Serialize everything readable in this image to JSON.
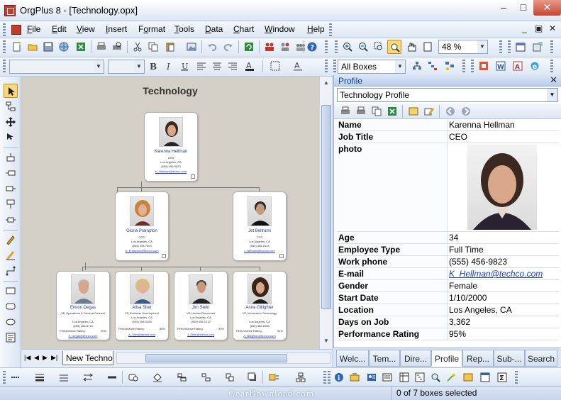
{
  "window": {
    "title": "OrgPlus 8 - [Technology.opx]",
    "minimize": "–",
    "maximize": "□",
    "close": "✕"
  },
  "menu": [
    "File",
    "Edit",
    "View",
    "Insert",
    "Format",
    "Tools",
    "Data",
    "Chart",
    "Window",
    "Help"
  ],
  "menu_underline": [
    "F",
    "E",
    "V",
    "I",
    "o",
    "T",
    "D",
    "C",
    "W",
    "H"
  ],
  "mdi_controls": {
    "minimize": "_",
    "restore": "▣",
    "close": "✕"
  },
  "toolbar": {
    "zoom": "48 %",
    "box_filter": "All Boxes",
    "font_name": "",
    "font_size": ""
  },
  "chart": {
    "title": "Technology",
    "boxes": [
      {
        "id": "ceo",
        "name": "Karenna Hellman",
        "title": "CEO",
        "location": "Los Angeles, CA",
        "phone": "(555) 456-9823",
        "email": "K_Hellman@techco.com"
      },
      {
        "id": "coo",
        "name": "Gloria Prampton",
        "title": "COO",
        "location": "Los Angeles, CA",
        "phone": "(555) 456-7003",
        "email": "G_Prampton@techco.com"
      },
      {
        "id": "cto",
        "name": "Jet Beltrami",
        "title": "CTO",
        "location": "Los Angeles, CA",
        "phone": "(555) 456-0149",
        "email": "J_Beltrami@techco.com"
      },
      {
        "id": "b1",
        "name": "Elmon Degas",
        "title": "VP, Operations & General Counsel",
        "location": "Los Angeles, CA",
        "phone": "(555) 456-8713",
        "email": "E_Degas@techco.com",
        "perf_label": "Performance Rating:",
        "perf": "90%"
      },
      {
        "id": "b2",
        "name": "Alisa Sher",
        "title": "VP, Business Development",
        "location": "Los Angeles, CA",
        "phone": "(555) 456-5183",
        "email": "A_Sher@techco.com",
        "perf_label": "Performance Rating:",
        "perf": "88%"
      },
      {
        "id": "b3",
        "name": "Jim Stein",
        "title": "VP, Human Resources",
        "location": "Los Angeles, CA",
        "phone": "(555) 456-1212",
        "email": "J_Stein@techco.com",
        "perf_label": "Performance Rating:",
        "perf": "90%"
      },
      {
        "id": "b4",
        "name": "Anna Gillighter",
        "title": "VP, Information Technology",
        "location": "Los Angeles, CA",
        "phone": "(555) 456-0080",
        "email": "A_Gillighter@techco.com",
        "perf_label": "Performance Rating:",
        "perf": "91%"
      }
    ]
  },
  "sheet_tab": "New Techno",
  "profile": {
    "header": "Profile",
    "selector": "Technology Profile",
    "rows": [
      {
        "key": "Name",
        "value": "Karenna Hellman"
      },
      {
        "key": "Job Title",
        "value": "CEO"
      },
      {
        "key": "photo",
        "value": ""
      },
      {
        "key": "Age",
        "value": "34"
      },
      {
        "key": "Employee Type",
        "value": "Full Time"
      },
      {
        "key": "Work phone",
        "value": "(555) 456-9823"
      },
      {
        "key": "E-mail",
        "value": "K_Hellman@techco.com"
      },
      {
        "key": "Gender",
        "value": "Female"
      },
      {
        "key": "Start Date",
        "value": "1/10/2000"
      },
      {
        "key": "Location",
        "value": "Los Angeles, CA"
      },
      {
        "key": "Days on Job",
        "value": "3,362"
      },
      {
        "key": "Performance Rating",
        "value": "95%"
      }
    ],
    "tabs": [
      "Welc...",
      "Tem...",
      "Dire...",
      "Profile",
      "Rep...",
      "Sub-...",
      "Search"
    ],
    "active_tab": "Profile"
  },
  "status": {
    "watermark": "GearDownload.com",
    "selection": "0 of 7 boxes selected"
  }
}
